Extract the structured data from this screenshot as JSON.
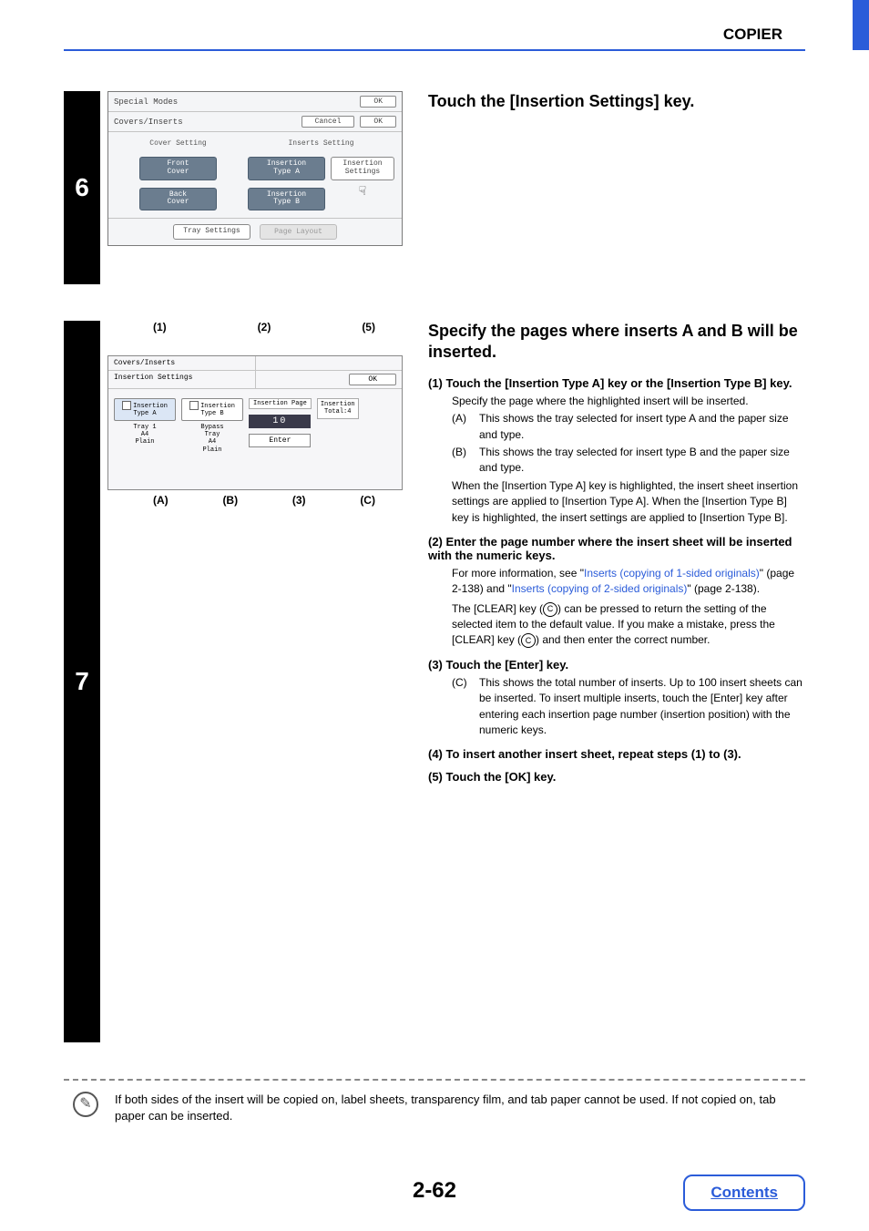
{
  "header": {
    "section": "COPIER"
  },
  "step6": {
    "number": "6",
    "title": "Touch the [Insertion Settings] key.",
    "panel": {
      "row1_title": "Special Modes",
      "row1_ok": "OK",
      "row2_title": "Covers/Inserts",
      "row2_cancel": "Cancel",
      "row2_ok": "OK",
      "cover_hdr": "Cover Setting",
      "inserts_hdr": "Inserts Setting",
      "front_cover": "Front\nCover",
      "back_cover": "Back\nCover",
      "ins_a": "Insertion\nType A",
      "ins_b": "Insertion\nType B",
      "ins_settings": "Insertion\nSettings",
      "tray_settings": "Tray Settings",
      "page_layout": "Page Layout"
    }
  },
  "step7": {
    "number": "7",
    "title": "Specify the pages where inserts A and B will be inserted.",
    "callouts_top": {
      "c1": "(1)",
      "c2": "(2)",
      "c5": "(5)"
    },
    "callouts_bot": {
      "cA": "(A)",
      "cB": "(B)",
      "c3": "(3)",
      "cC": "(C)"
    },
    "panel": {
      "hdr_l": "Covers/Inserts",
      "hdr2_l": "Insertion Settings",
      "ok": "OK",
      "key_a": "Insertion\nType A",
      "key_b": "Insertion\nType B",
      "tray_a": "Tray 1\nA4\nPlain",
      "tray_b": "Bypass\nTray\nA4\nPlain",
      "ins_page": "Insertion Page",
      "num": "10",
      "enter": "Enter",
      "total": "Insertion\nTotal:4"
    },
    "items": {
      "i1": {
        "num": "(1)",
        "label": "Touch the [Insertion Type A] key or the [Insertion Type B] key.",
        "body1": "Specify the page where the highlighted insert will be inserted.",
        "a_let": "(A)",
        "a_txt": "This shows the tray selected for insert type A and the paper size and type.",
        "b_let": "(B)",
        "b_txt": "This shows the tray selected for insert type B and the paper size and type.",
        "tail": "When the [Insertion Type A] key is highlighted, the insert sheet insertion settings are applied to [Insertion Type A]. When the [Insertion Type B] key is highlighted, the insert settings are applied to [Insertion Type B]."
      },
      "i2": {
        "num": "(2)",
        "label": "Enter the page number where the insert sheet will be inserted with the numeric keys.",
        "pre": "For more information, see \"",
        "link1": "Inserts (copying of 1-sided originals)",
        "mid1": "\" (page 2-138) and \"",
        "link2": "Inserts (copying of 2-sided originals)",
        "mid2": "\" (page 2-138).",
        "clear1a": "The [CLEAR] key (",
        "clear1b": ") can be pressed to return the setting of the selected item to the default value. If you make a mistake, press the [CLEAR] key (",
        "clear1c": ") and then enter the correct number.",
        "clear_glyph": "C"
      },
      "i3": {
        "num": "(3)",
        "label": "Touch the [Enter] key.",
        "c_let": "(C)",
        "c_txt": "This shows the total number of inserts. Up to 100 insert sheets can be inserted. To insert multiple inserts, touch the [Enter] key after entering each insertion page number (insertion position) with the numeric keys."
      },
      "i4": {
        "num": "(4)",
        "label": "To insert another insert sheet, repeat steps (1) to (3)."
      },
      "i5": {
        "num": "(5)",
        "label": "Touch the [OK] key."
      }
    }
  },
  "note": "If both sides of the insert will be copied on, label sheets, transparency film, and tab paper cannot be used. If not copied on, tab paper can be inserted.",
  "footer": {
    "page": "2-62",
    "contents": "Contents"
  }
}
